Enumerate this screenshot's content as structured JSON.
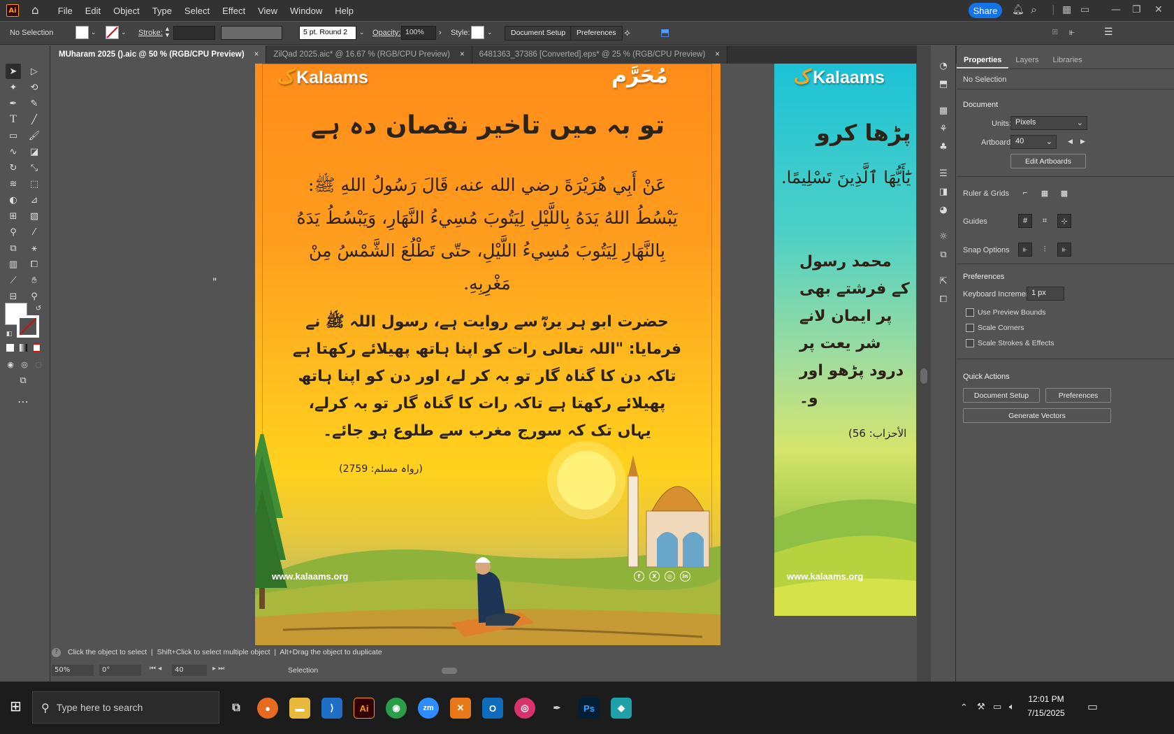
{
  "menubar": {
    "logo": "Ai",
    "items": [
      "File",
      "Edit",
      "Object",
      "Type",
      "Select",
      "Effect",
      "View",
      "Window",
      "Help"
    ],
    "share": "Share"
  },
  "control": {
    "selection": "No Selection",
    "stroke_label": "Stroke:",
    "brush": "5 pt. Round 2",
    "opacity_label": "Opacity:",
    "opacity": "100%",
    "style_label": "Style:",
    "doc_setup": "Document Setup",
    "preferences": "Preferences"
  },
  "tabs": [
    {
      "label": "MUharam 2025 ().aic @ 50 % (RGB/CPU Preview)",
      "x": "×"
    },
    {
      "label": "ZilQad 2025.aic* @ 16.67 % (RGB/CPU Preview)",
      "x": "×"
    },
    {
      "label": "6481363_37386 [Converted].eps* @ 25 % (RGB/CPU Preview)",
      "x": "×"
    }
  ],
  "art1": {
    "brand": "Kalaams",
    "brand_mark": "ک",
    "month": "مُحَرَّم",
    "title": "تو بہ میں تاخیر نقصان دہ ہے",
    "arabic": "عَنْ أَبِي هُرَيْرَةَ رضي الله عنه، قَالَ رَسُولُ اللهِ ﷺ: يَبْسُطُ اللهُ يَدَهُ بِاللَّيْلِ لِيَتُوبَ مُسِيءُ النَّهَارِ، وَيَبْسُطُ يَدَهُ بِالنَّهَارِ لِيَتُوبَ مُسِيءُ اللَّيْلِ، حتّى تَطْلُعَ الشَّمْسُ مِنْ مَغْرِبِهِ.",
    "urdu": "حضرت ابو ہر یرہؓ سے روایت ہے، رسول اللہ ﷺ نے فرمایا: \"اللہ تعالی رات کو اپنا ہاتھ پھیلائے رکھتا ہے تاکہ دن کا گناہ گار تو بہ کر لے، اور دن کو اپنا ہاتھ پھیلائے رکھتا ہے تاکہ رات کا گناہ گار تو بہ کرلے، یہاں تک کہ سورج مغرب سے طلوع ہو جائے۔",
    "ref": "(رواہ مسلم: 2759)",
    "url": "www.kalaams.org",
    "social": [
      "f",
      "X",
      "◎",
      "in"
    ]
  },
  "art2": {
    "brand": "Kalaams",
    "brand_mark": "ک",
    "title": "پڑھا کرو",
    "arabic": "يَٰٓأَيُّهَا ٱلَّذِينَ تَسْلِيمًا.",
    "urdu": [
      "محمد رسول",
      "کے فرشتے بھی",
      "پر ایمان لانے",
      "شر یعت پر",
      "درود پڑھو اور",
      "و۔"
    ],
    "ref": "(الأحزاب: 56",
    "url": "www.kalaams.org"
  },
  "props": {
    "tabs": [
      "Properties",
      "Layers",
      "Libraries"
    ],
    "no_selection": "No Selection",
    "document": "Document",
    "units_label": "Units:",
    "units": "Pixels",
    "artboard_label": "Artboard:",
    "artboard": "40",
    "edit_artboards": "Edit Artboards",
    "ruler_grids": "Ruler & Grids",
    "guides": "Guides",
    "snap": "Snap Options",
    "preferences": "Preferences",
    "keyboard_increment_label": "Keyboard Increment:",
    "keyboard_increment": "1 px",
    "use_preview_bounds": "Use Preview Bounds",
    "scale_corners": "Scale Corners",
    "scale_strokes": "Scale Strokes & Effects",
    "quick_actions": "Quick Actions",
    "document_setup": "Document Setup",
    "preferences_btn": "Preferences",
    "generate_vectors": "Generate Vectors"
  },
  "status": {
    "hint": "Click the object to select  |  Shift+Click to select multiple object  |  Alt+Drag the object to duplicate",
    "zoom": "50%",
    "rotate": "0°",
    "artboard": "40",
    "mode": "Selection"
  },
  "taskbar": {
    "search": "Type here to search",
    "time": "12:01 PM",
    "date": "7/15/2025"
  }
}
